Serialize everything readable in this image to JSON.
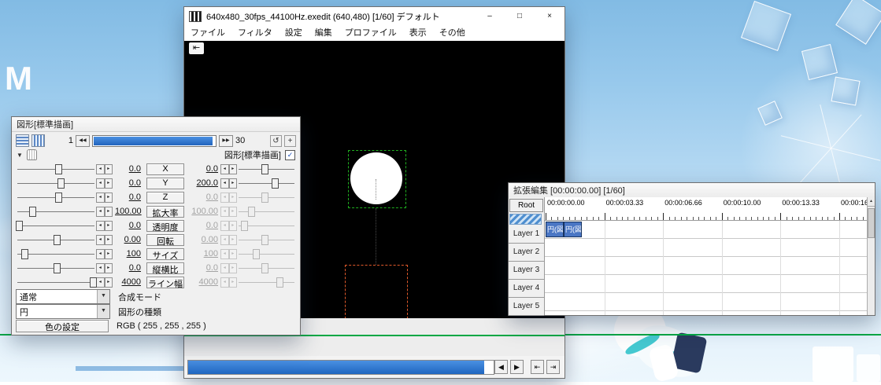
{
  "desktop": {
    "m_label": "M"
  },
  "main_window": {
    "title": "640x480_30fps_44100Hz.exedit (640,480) [1/60] デフォルト",
    "controls": {
      "minimize": "–",
      "maximize": "□",
      "close": "×"
    },
    "menu": [
      "ファイル",
      "フィルタ",
      "設定",
      "編集",
      "プロファイル",
      "表示",
      "その他"
    ],
    "video": {
      "jump_icon": "⇤"
    },
    "transport": {
      "progress_pct": 97,
      "buttons": [
        {
          "name": "prev-frame",
          "glyph": "◀"
        },
        {
          "name": "next-frame",
          "glyph": "▶"
        },
        {
          "name": "jump-start",
          "glyph": "⇤"
        },
        {
          "name": "jump-end",
          "glyph": "⇥"
        }
      ]
    }
  },
  "settings": {
    "title": "図形[標準描画]",
    "toolbar": {
      "start_frame": "1",
      "prev": "◀◀",
      "next": "▶▶",
      "end_frame": "30",
      "refresh": "↺",
      "add": "+"
    },
    "header": {
      "collapse": "▼",
      "label": "図形[標準描画]",
      "check": "✓"
    },
    "spin": {
      "dec": "◂",
      "inc": "▸"
    },
    "params": [
      {
        "name": "X",
        "start": "0.0",
        "end": "0.0",
        "end_disabled": false,
        "start_pct": 52,
        "end_pct": 45
      },
      {
        "name": "Y",
        "start": "0.0",
        "end": "200.0",
        "end_disabled": false,
        "start_pct": 55,
        "end_pct": 62
      },
      {
        "name": "Z",
        "start": "0.0",
        "end": "0.0",
        "end_disabled": true,
        "start_pct": 52,
        "end_pct": 45
      },
      {
        "name": "拡大率",
        "start": "100.00",
        "end": "100.00",
        "end_disabled": true,
        "start_pct": 20,
        "end_pct": 22
      },
      {
        "name": "透明度",
        "start": "0.0",
        "end": "0.0",
        "end_disabled": true,
        "start_pct": 3,
        "end_pct": 10
      },
      {
        "name": "回転",
        "start": "0.00",
        "end": "0.00",
        "end_disabled": true,
        "start_pct": 50,
        "end_pct": 45
      },
      {
        "name": "サイズ",
        "start": "100",
        "end": "100",
        "end_disabled": true,
        "start_pct": 10,
        "end_pct": 30
      },
      {
        "name": "縦横比",
        "start": "0.0",
        "end": "0.0",
        "end_disabled": true,
        "start_pct": 50,
        "end_pct": 45
      },
      {
        "name": "ライン幅",
        "start": "4000",
        "end": "4000",
        "end_disabled": true,
        "start_pct": 95,
        "end_pct": 70
      }
    ],
    "blend": {
      "value": "通常",
      "label": "合成モード",
      "arrow": "▼"
    },
    "shape": {
      "value": "円",
      "label": "図形の種類",
      "arrow": "▼"
    },
    "color": {
      "button": "色の設定",
      "value": "RGB ( 255 , 255 , 255 )"
    }
  },
  "timeline": {
    "title": "拡張編集 [00:00:00.00] [1/60]",
    "root": "Root",
    "time_labels": [
      "00:00:00.00",
      "00:00:03.33",
      "00:00:06.66",
      "00:00:10.00",
      "00:00:13.33",
      "00:00:16"
    ],
    "layers": [
      "Layer 1",
      "Layer 2",
      "Layer 3",
      "Layer 4",
      "Layer 5"
    ],
    "objects": [
      {
        "label": "円(図",
        "layer": 0
      },
      {
        "label": "円(図",
        "layer": 0
      }
    ],
    "scroll_up": "▲"
  }
}
